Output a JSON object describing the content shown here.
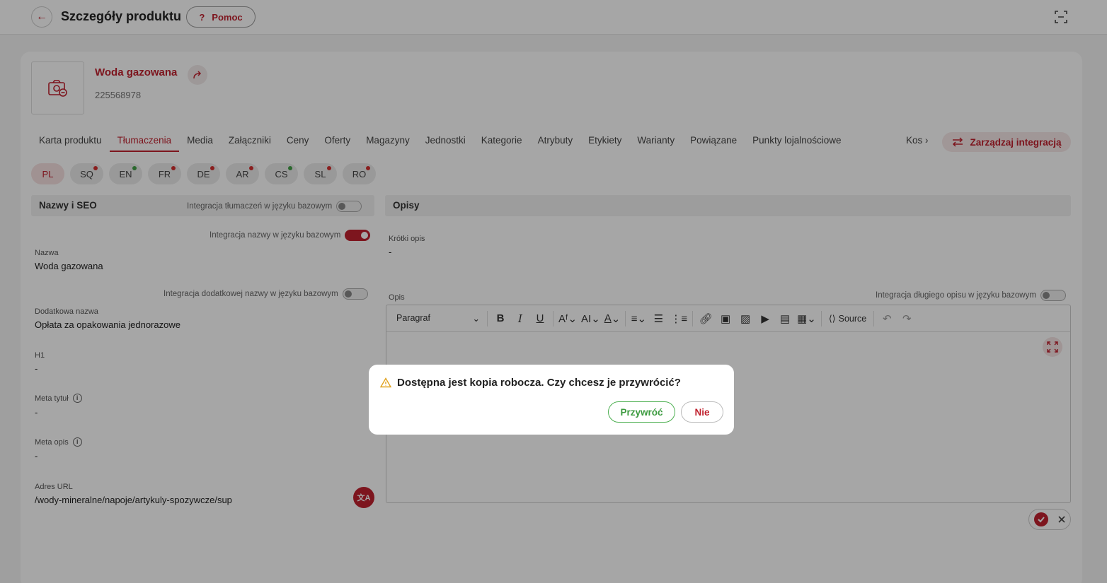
{
  "header": {
    "title": "Szczegóły produktu",
    "help_label": "Pomoc",
    "help_icon": "?"
  },
  "product": {
    "name": "Woda gazowana",
    "code": "225568978"
  },
  "tabs": [
    {
      "label": "Karta produktu"
    },
    {
      "label": "Tłumaczenia",
      "active": true
    },
    {
      "label": "Media"
    },
    {
      "label": "Załączniki"
    },
    {
      "label": "Ceny"
    },
    {
      "label": "Oferty"
    },
    {
      "label": "Magazyny"
    },
    {
      "label": "Jednostki"
    },
    {
      "label": "Kategorie"
    },
    {
      "label": "Atrybuty"
    },
    {
      "label": "Etykiety"
    },
    {
      "label": "Warianty"
    },
    {
      "label": "Powiązane"
    },
    {
      "label": "Punkty lojalnościowe"
    }
  ],
  "tab_more": "Kos",
  "manage_integration_label": "Zarządzaj integracją",
  "languages": [
    {
      "code": "PL",
      "active": true,
      "dot": null
    },
    {
      "code": "SQ",
      "dot": "#d32f2f"
    },
    {
      "code": "EN",
      "dot": "#43a047"
    },
    {
      "code": "FR",
      "dot": "#d32f2f"
    },
    {
      "code": "DE",
      "dot": "#d32f2f"
    },
    {
      "code": "AR",
      "dot": "#d32f2f"
    },
    {
      "code": "CS",
      "dot": "#43a047"
    },
    {
      "code": "SL",
      "dot": "#d32f2f"
    },
    {
      "code": "RO",
      "dot": "#d32f2f"
    }
  ],
  "seo": {
    "title": "Nazwy i SEO",
    "integration_translations": "Integracja tłumaczeń w języku bazowym",
    "integration_name": "Integracja nazwy w języku bazowym",
    "integration_extra_name": "Integracja dodatkowej nazwy w języku bazowym",
    "fields": {
      "name_label": "Nazwa",
      "name_value": "Woda gazowana",
      "extra_label": "Dodatkowa nazwa",
      "extra_value": "Opłata za opakowania jednorazowe",
      "h1_label": "H1",
      "h1_value": "-",
      "meta_title_label": "Meta tytuł",
      "meta_title_value": "-",
      "meta_desc_label": "Meta opis",
      "meta_desc_value": "-",
      "url_label": "Adres URL",
      "url_value": "/wody-mineralne/napoje/artykuly-spozywcze/sup"
    }
  },
  "descriptions": {
    "title": "Opisy",
    "short_label": "Krótki opis",
    "short_value": "-",
    "long_label": "Opis",
    "integration_long": "Integracja długiego opisu w języku bazowym",
    "paragraph_select": "Paragraf",
    "source_label": "Source"
  },
  "dialog": {
    "message": "Dostępna jest kopia robocza. Czy chcesz je przywrócić?",
    "restore_label": "Przywróć",
    "no_label": "Nie"
  },
  "colors": {
    "accent": "#c0212e",
    "success": "#3d9b40"
  }
}
